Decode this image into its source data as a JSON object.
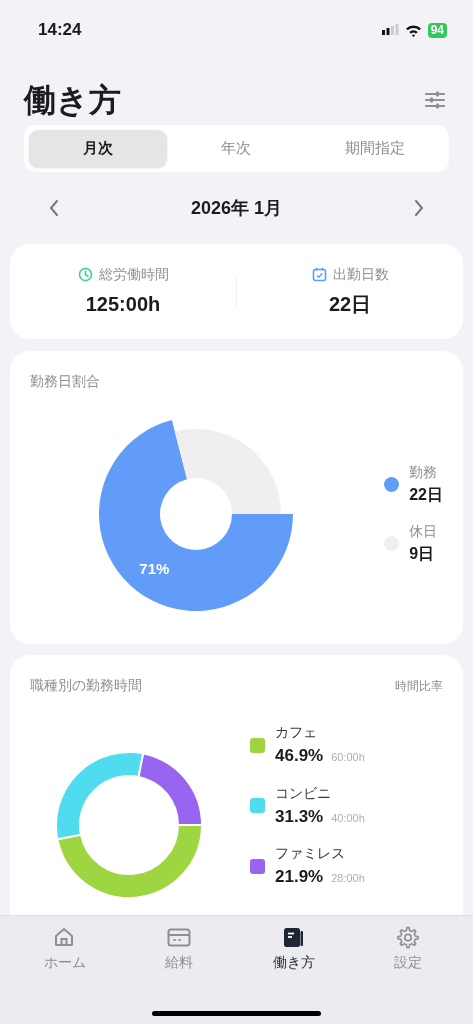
{
  "status_bar": {
    "time": "14:24",
    "battery": "94"
  },
  "header": {
    "title": "働き方"
  },
  "tabs": [
    {
      "label": "月次",
      "selected": true
    },
    {
      "label": "年次",
      "selected": false
    },
    {
      "label": "期間指定",
      "selected": false
    }
  ],
  "period": {
    "label": "2026年 1月"
  },
  "summary": [
    {
      "kind": "clock",
      "label": "総労働時間",
      "value": "125:00h"
    },
    {
      "kind": "calendar",
      "label": "出勤日数",
      "value": "22日"
    }
  ],
  "workday_ratio": {
    "title": "勤務日割合",
    "chart_data": {
      "type": "donut",
      "categories": [
        "勤務",
        "休日"
      ],
      "values": [
        71,
        29
      ],
      "value_labels": [
        "71%",
        null
      ]
    },
    "legend": [
      {
        "value": "22日",
        "color": "#619cf9"
      },
      {
        "value": "9日",
        "color": "#efefef"
      }
    ]
  },
  "job_hours": {
    "title": "職種別の勤務時間",
    "caption": "時間比率",
    "chart_data": {
      "type": "donut",
      "categories": [
        "カフェ",
        "コンビニ",
        "ファミレス"
      ],
      "values": [
        46.9,
        31.3,
        21.9
      ]
    },
    "legend": [
      {
        "percent": "46.9%",
        "hours": "60:00h",
        "color": "#9ed641"
      },
      {
        "percent": "31.3%",
        "hours": "40:00h",
        "color": "#4fdcef"
      },
      {
        "percent": "21.9%",
        "hours": "28:00h",
        "color": "#9765f0"
      }
    ]
  },
  "tab_bar": [
    {
      "kind": "home",
      "label": "ホーム",
      "selected": false
    },
    {
      "kind": "card",
      "label": "給料",
      "selected": false
    },
    {
      "kind": "book",
      "label": "働き方",
      "selected": true
    },
    {
      "kind": "gear",
      "label": "設定",
      "selected": false
    }
  ]
}
